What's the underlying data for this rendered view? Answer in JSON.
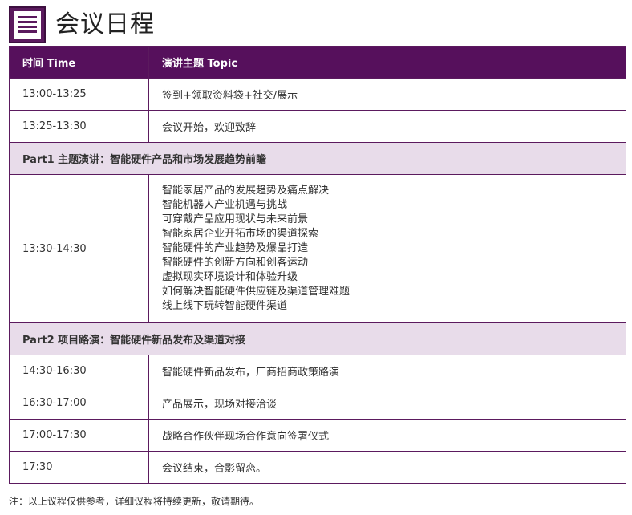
{
  "page": {
    "title": "会议日程",
    "icon": "document-list-icon",
    "accent_color": "#56105c",
    "section_color": "#e8dcea"
  },
  "table": {
    "header": {
      "time": "时间 Time",
      "topic": "演讲主题 Topic"
    },
    "rows": [
      {
        "type": "item",
        "time": "13:00-13:25",
        "topic": "签到+领取资料袋+社交/展示"
      },
      {
        "type": "item",
        "time": "13:25-13:30",
        "topic": "会议开始，欢迎致辞"
      },
      {
        "type": "section",
        "label": "Part1 主题演讲：智能硬件产品和市场发展趋势前瞻"
      },
      {
        "type": "multi",
        "time": "13:30-14:30",
        "topics": [
          "智能家居产品的发展趋势及痛点解决",
          "智能机器人产业机遇与挑战",
          "可穿戴产品应用现状与未来前景",
          "智能家居企业开拓市场的渠道探索",
          "智能硬件的产业趋势及爆品打造",
          "智能硬件的创新方向和创客运动",
          "虚拟现实环境设计和体验升级",
          "如何解决智能硬件供应链及渠道管理难题",
          "线上线下玩转智能硬件渠道"
        ]
      },
      {
        "type": "section",
        "label": "Part2 项目路演：智能硬件新品发布及渠道对接"
      },
      {
        "type": "item",
        "time": "14:30-16:30",
        "topic": "智能硬件新品发布，厂商招商政策路演"
      },
      {
        "type": "item",
        "time": "16:30-17:00",
        "topic": "产品展示，现场对接洽谈"
      },
      {
        "type": "item",
        "time": "17:00-17:30",
        "topic": "战略合作伙伴现场合作意向签署仪式"
      },
      {
        "type": "item",
        "time": "17:30",
        "topic": "会议结束，合影留恋。"
      }
    ]
  },
  "footer": {
    "note": "注：以上议程仅供参考，详细议程将持续更新，敬请期待。"
  }
}
